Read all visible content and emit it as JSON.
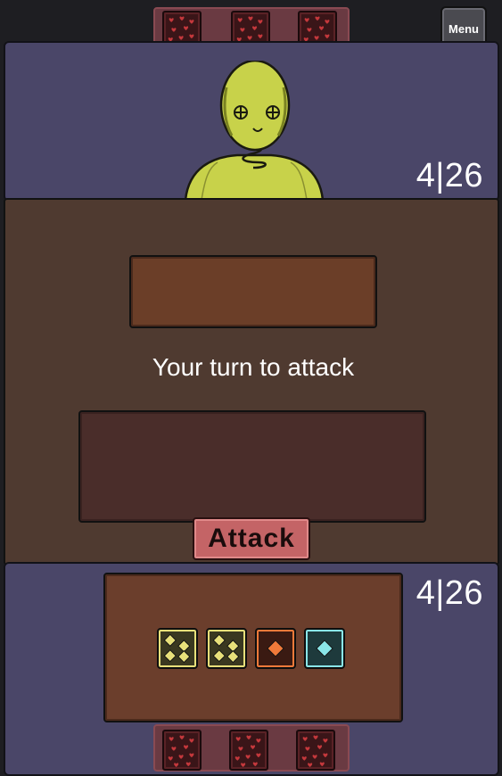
{
  "menu": {
    "label": "Menu"
  },
  "opponent": {
    "score": "4|26",
    "cards": [
      {
        "icon": "heart-pattern-card-icon"
      },
      {
        "icon": "heart-pattern-card-icon"
      },
      {
        "icon": "heart-pattern-card-icon"
      }
    ]
  },
  "battle": {
    "status": "Your turn to attack",
    "attack_label": "Attack"
  },
  "player": {
    "score": "4|26",
    "dice": [
      {
        "type": "yellow",
        "pips": 4,
        "color": "#e8e07a"
      },
      {
        "type": "yellow",
        "pips": 4,
        "color": "#e8e07a"
      },
      {
        "type": "orange",
        "pips": 1,
        "color": "#f07a3a"
      },
      {
        "type": "cyan",
        "pips": 1,
        "color": "#8ae6e8"
      }
    ],
    "cards": [
      {
        "icon": "heart-pattern-card-icon"
      },
      {
        "icon": "heart-pattern-card-icon"
      },
      {
        "icon": "heart-pattern-card-icon"
      }
    ]
  },
  "colors": {
    "panel_blue": "#4a4668",
    "panel_brown": "#4f3a30",
    "attack_button": "#c46466",
    "character_skin": "#c8d24a"
  }
}
